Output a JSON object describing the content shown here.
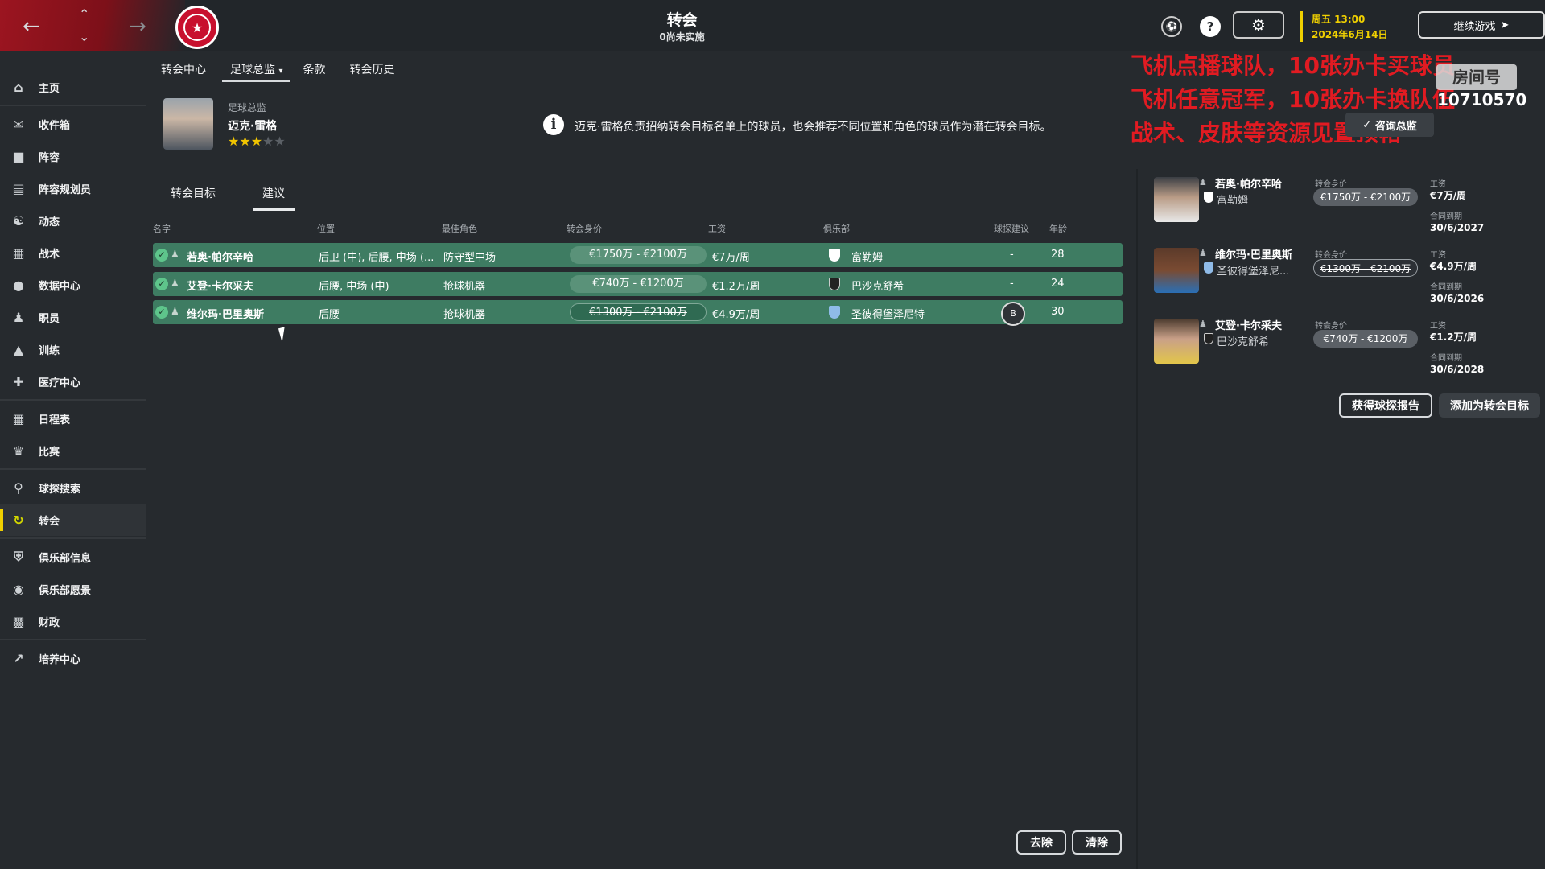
{
  "header": {
    "title": "转会",
    "subtitle": "0尚未实施",
    "date_day": "周五 13:00",
    "date_full": "2024年6月14日",
    "continue_label": "继续游戏",
    "settings_icon": "gear-icon",
    "help_icon": "help-icon"
  },
  "overlay": {
    "line1": "飞机点播球队，10张办卡买球员",
    "line2": "飞机任意冠军，10张办卡换队伍",
    "line3": "战术、皮肤等资源见置顶帖",
    "watermark_label": "房间号",
    "room_number": "10710570"
  },
  "sidebar": {
    "items": [
      {
        "label": "主页",
        "icon": "home-icon"
      },
      {
        "label": "收件箱",
        "icon": "inbox-icon"
      },
      {
        "label": "阵容",
        "icon": "shirt-icon"
      },
      {
        "label": "阵容规划员",
        "icon": "clipboard-icon"
      },
      {
        "label": "动态",
        "icon": "dynamics-icon"
      },
      {
        "label": "战术",
        "icon": "tactics-icon"
      },
      {
        "label": "数据中心",
        "icon": "data-icon"
      },
      {
        "label": "职员",
        "icon": "staff-icon"
      },
      {
        "label": "训练",
        "icon": "training-icon"
      },
      {
        "label": "医疗中心",
        "icon": "medical-icon"
      },
      {
        "label": "日程表",
        "icon": "calendar-icon"
      },
      {
        "label": "比赛",
        "icon": "trophy-icon"
      },
      {
        "label": "球探搜索",
        "icon": "search-icon"
      },
      {
        "label": "转会",
        "icon": "transfer-icon"
      },
      {
        "label": "俱乐部信息",
        "icon": "shield-icon"
      },
      {
        "label": "俱乐部愿景",
        "icon": "vision-icon"
      },
      {
        "label": "财政",
        "icon": "finance-icon"
      },
      {
        "label": "培养中心",
        "icon": "development-icon"
      }
    ]
  },
  "subtabs": [
    "转会中心",
    "足球总监",
    "条款",
    "转会历史"
  ],
  "director": {
    "role": "足球总监",
    "name": "迈克·雷格",
    "stars": 3,
    "stars_max": 5,
    "info": "迈克·雷格负责招纳转会目标名单上的球员，也会推荐不同位置和角色的球员作为潜在转会目标。",
    "check_label": "咨询总监"
  },
  "tabs": [
    "转会目标",
    "建议"
  ],
  "columns": {
    "name": "名字",
    "position": "位置",
    "role": "最佳角色",
    "value": "转会身价",
    "wage": "工资",
    "club": "俱乐部",
    "scout": "球探建议",
    "age": "年龄"
  },
  "rows": [
    {
      "name": "若奥·帕尔辛哈",
      "position": "后卫 (中), 后腰, 中场 (...",
      "role": "防守型中场",
      "value": "€1750万 - €2100万",
      "wage": "€7万/周",
      "club": "富勒姆",
      "scout": "-",
      "age": "28"
    },
    {
      "name": "艾登·卡尔采夫",
      "position": "后腰, 中场 (中)",
      "role": "抢球机器",
      "value": "€740万 - €1200万",
      "wage": "€1.2万/周",
      "club": "巴沙克舒希",
      "scout": "-",
      "age": "24"
    },
    {
      "name": "维尔玛·巴里奥斯",
      "position": "后腰",
      "role": "抢球机器",
      "value": "€1300万 - €2100万",
      "wage": "€4.9万/周",
      "club": "圣彼得堡泽尼特",
      "scout": "B",
      "age": "30"
    }
  ],
  "bottom": {
    "remove_label": "去除",
    "clear_label": "清除"
  },
  "right_panel": {
    "value_label": "转会身价",
    "wage_label": "工资",
    "contract_label": "合同到期",
    "cards": [
      {
        "name": "若奥·帕尔辛哈",
        "club": "富勒姆",
        "value": "€1750万 - €2100万",
        "wage": "€7万/周",
        "contract": "30/6/2027"
      },
      {
        "name": "维尔玛·巴里奥斯",
        "club": "圣彼得堡泽尼...",
        "value": "€1300万 - €2100万",
        "wage": "€4.9万/周",
        "contract": "30/6/2026"
      },
      {
        "name": "艾登·卡尔采夫",
        "club": "巴沙克舒希",
        "value": "€740万 - €1200万",
        "wage": "€1.2万/周",
        "contract": "30/6/2028"
      }
    ],
    "scout_button": "获得球探报告",
    "add_button": "添加为转会目标"
  },
  "colors": {
    "row_green": "#3e7c62",
    "accent_yellow": "#f0d000",
    "overlay_red": "#e11b22",
    "background": "#262a2e"
  }
}
